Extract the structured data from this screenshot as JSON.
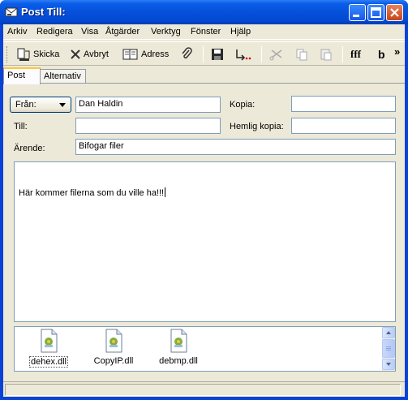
{
  "window": {
    "title": "Post Till:"
  },
  "menu": [
    "Arkiv",
    "Redigera",
    "Visa",
    "Åtgärder",
    "Verktyg",
    "Fönster",
    "Hjälp"
  ],
  "toolbar": {
    "send_label": "Skicka",
    "cancel_label": "Avbryt",
    "address_label": "Adress",
    "font_label": "fff",
    "bold_label": "b",
    "overflow_label": "»"
  },
  "tabs": [
    "Post",
    "Alternativ"
  ],
  "form": {
    "from_label": "Från:",
    "from_value": "Dan Haldin",
    "to_label": "Till:",
    "to_value": "",
    "subject_label": "Ärende:",
    "subject_value": "Bifogar filer",
    "cc_label": "Kopia:",
    "cc_value": "",
    "bcc_label": "Hemlig kopia:",
    "bcc_value": ""
  },
  "message": {
    "body": "Här kommer filerna som du ville ha!!!"
  },
  "attachments": [
    {
      "name": "dehex.dll",
      "selected": true
    },
    {
      "name": "CopyIP.dll",
      "selected": false
    },
    {
      "name": "debmp.dll",
      "selected": false
    }
  ],
  "colors": {
    "titlebar": "#0a5de8",
    "face": "#ece9d8",
    "border": "#7f9db9"
  }
}
